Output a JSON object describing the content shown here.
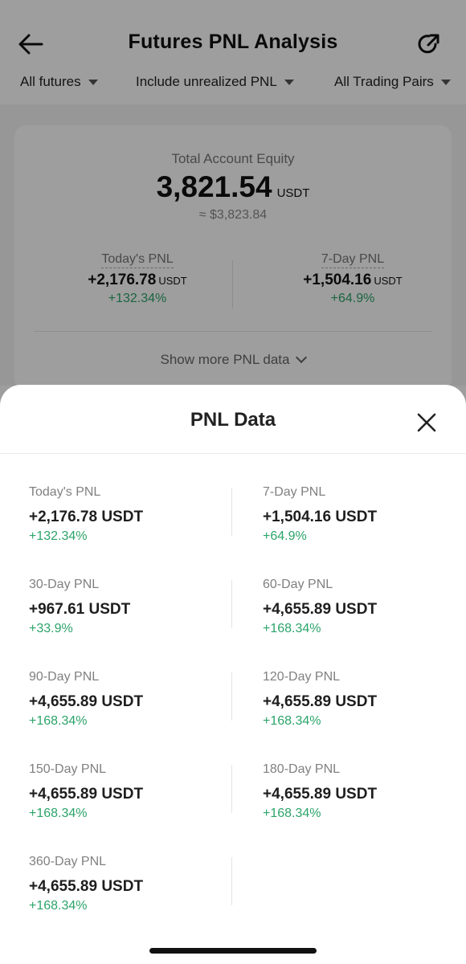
{
  "header": {
    "title": "Futures PNL Analysis",
    "back_icon": "arrow-left-icon",
    "refresh_icon": "refresh-icon"
  },
  "filters": [
    {
      "label": "All futures"
    },
    {
      "label": "Include unrealized PNL"
    },
    {
      "label": "All Trading Pairs"
    }
  ],
  "equity": {
    "label": "Total Account Equity",
    "value": "3,821.54",
    "unit": "USDT",
    "approx": "≈ $3,823.84"
  },
  "summary": [
    {
      "label": "Today's PNL",
      "value": "+2,176.78",
      "unit": "USDT",
      "pct": "+132.34%"
    },
    {
      "label": "7-Day PNL",
      "value": "+1,504.16",
      "unit": "USDT",
      "pct": "+64.9%"
    }
  ],
  "show_more": {
    "label": "Show more PNL data"
  },
  "sheet": {
    "title": "PNL Data",
    "close_icon": "close-icon",
    "items": [
      {
        "label": "Today's PNL",
        "value": "+2,176.78 USDT",
        "pct": "+132.34%"
      },
      {
        "label": "7-Day PNL",
        "value": "+1,504.16 USDT",
        "pct": "+64.9%"
      },
      {
        "label": "30-Day PNL",
        "value": "+967.61 USDT",
        "pct": "+33.9%"
      },
      {
        "label": "60-Day PNL",
        "value": "+4,655.89 USDT",
        "pct": "+168.34%"
      },
      {
        "label": "90-Day PNL",
        "value": "+4,655.89 USDT",
        "pct": "+168.34%"
      },
      {
        "label": "120-Day PNL",
        "value": "+4,655.89 USDT",
        "pct": "+168.34%"
      },
      {
        "label": "150-Day PNL",
        "value": "+4,655.89 USDT",
        "pct": "+168.34%"
      },
      {
        "label": "180-Day PNL",
        "value": "+4,655.89 USDT",
        "pct": "+168.34%"
      },
      {
        "label": "360-Day PNL",
        "value": "+4,655.89 USDT",
        "pct": "+168.34%"
      }
    ]
  },
  "colors": {
    "positive": "#2ca46a",
    "overlay": "rgba(0,0,0,0.38)"
  }
}
